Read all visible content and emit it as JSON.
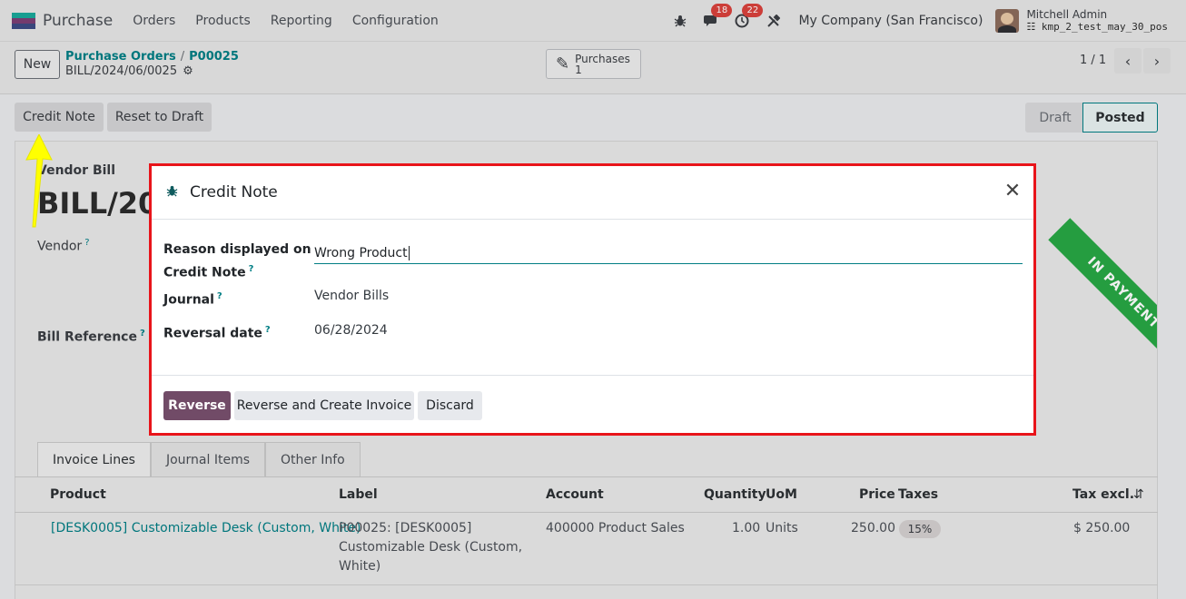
{
  "navbar": {
    "app_name": "Purchase",
    "menu": [
      "Orders",
      "Products",
      "Reporting",
      "Configuration"
    ],
    "messages_count": "18",
    "activities_count": "22",
    "company": "My Company (San Francisco)",
    "user_name": "Mitchell Admin",
    "db_name": "kmp_2_test_may_30_pos"
  },
  "control_panel": {
    "new_label": "New",
    "breadcrumb_parent": "Purchase Orders",
    "breadcrumb_current": "P00025",
    "record_name": "BILL/2024/06/0025",
    "smart_button": {
      "label": "Purchases",
      "count": "1"
    },
    "pager": "1 / 1"
  },
  "form": {
    "credit_note_label": "Credit Note",
    "reset_to_draft_label": "Reset to Draft",
    "status": [
      "Draft",
      "Posted"
    ],
    "ribbon": "IN PAYMENT",
    "doc_type": "Vendor Bill",
    "big_title": "BILL/20",
    "vendor_label": "Vendor",
    "bill_reference_label": "Bill Reference",
    "tabs": [
      "Invoice Lines",
      "Journal Items",
      "Other Info"
    ],
    "table_headers": [
      "Product",
      "Label",
      "Account",
      "Quantity",
      "UoM",
      "Price",
      "Taxes",
      "Tax excl."
    ],
    "row": {
      "product": "[DESK0005] Customizable Desk (Custom, White)",
      "label_line1": "P00025: [DESK0005]",
      "label_line2": "Customizable Desk (Custom,",
      "label_line3": "White)",
      "account": "400000 Product Sales",
      "quantity": "1.00",
      "uom": "Units",
      "price": "250.00",
      "taxes": "15%",
      "tax_excl": "$ 250.00"
    }
  },
  "modal": {
    "title": "Credit Note",
    "reason_label_line1": "Reason displayed on",
    "reason_label_line2": "Credit Note",
    "reason_value": "Wrong Product",
    "journal_label": "Journal",
    "journal_value": "Vendor Bills",
    "reversal_date_label": "Reversal date",
    "reversal_date_value": "06/28/2024",
    "buttons": {
      "reverse": "Reverse",
      "reverse_create": "Reverse and Create Invoice",
      "discard": "Discard"
    }
  },
  "colors": {
    "brand": "#714b67",
    "accent": "#017e84",
    "highlight": "#e8141a",
    "ribbon": "#28a745",
    "arrow": "#ffff00"
  }
}
